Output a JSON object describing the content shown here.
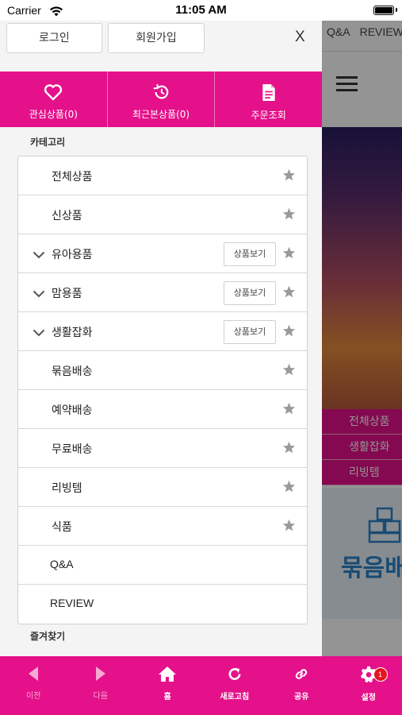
{
  "status_bar": {
    "carrier": "Carrier",
    "time": "11:05 AM"
  },
  "background_page": {
    "tabs": [
      "Q&A",
      "REVIEW"
    ],
    "categories": [
      "전체상품",
      "생활잡화",
      "리빙템"
    ],
    "banner_text": "묶음배"
  },
  "drawer": {
    "login_label": "로그인",
    "signup_label": "회원가입",
    "close_label": "X",
    "quick_links": [
      {
        "label": "관심상품(0)",
        "icon": "heart-icon"
      },
      {
        "label": "최근본상품(0)",
        "icon": "history-icon"
      },
      {
        "label": "주문조회",
        "icon": "document-icon"
      }
    ],
    "category_title": "카테고리",
    "categories": [
      {
        "label": "전체상품",
        "expandable": false,
        "view_button": "",
        "star": true
      },
      {
        "label": "신상품",
        "expandable": false,
        "view_button": "",
        "star": true
      },
      {
        "label": "유아용품",
        "expandable": true,
        "view_button": "상품보기",
        "star": true
      },
      {
        "label": "맘용품",
        "expandable": true,
        "view_button": "상품보기",
        "star": true
      },
      {
        "label": "생활잡화",
        "expandable": true,
        "view_button": "상품보기",
        "star": true
      },
      {
        "label": "묶음배송",
        "expandable": false,
        "view_button": "",
        "star": true
      },
      {
        "label": "예약배송",
        "expandable": false,
        "view_button": "",
        "star": true
      },
      {
        "label": "무료배송",
        "expandable": false,
        "view_button": "",
        "star": true
      },
      {
        "label": "리빙템",
        "expandable": false,
        "view_button": "",
        "star": true
      },
      {
        "label": "식품",
        "expandable": false,
        "view_button": "",
        "star": true
      },
      {
        "label": "Q&A",
        "expandable": false,
        "view_button": "",
        "star": false
      },
      {
        "label": "REVIEW",
        "expandable": false,
        "view_button": "",
        "star": false
      }
    ],
    "favorites_title": "즐겨찾기"
  },
  "tab_bar": {
    "tabs": [
      {
        "label": "이전",
        "icon": "back-arrow-icon",
        "enabled": false
      },
      {
        "label": "다음",
        "icon": "forward-arrow-icon",
        "enabled": false
      },
      {
        "label": "홈",
        "icon": "home-icon",
        "enabled": true
      },
      {
        "label": "새로고침",
        "icon": "refresh-icon",
        "enabled": true
      },
      {
        "label": "공유",
        "icon": "share-link-icon",
        "enabled": true
      },
      {
        "label": "설정",
        "icon": "gear-icon",
        "enabled": true
      }
    ],
    "settings_badge": "1"
  },
  "colors": {
    "brand_pink": "#e4118a",
    "badge_red": "#e8141f",
    "star_gray": "#9a9a9a"
  }
}
